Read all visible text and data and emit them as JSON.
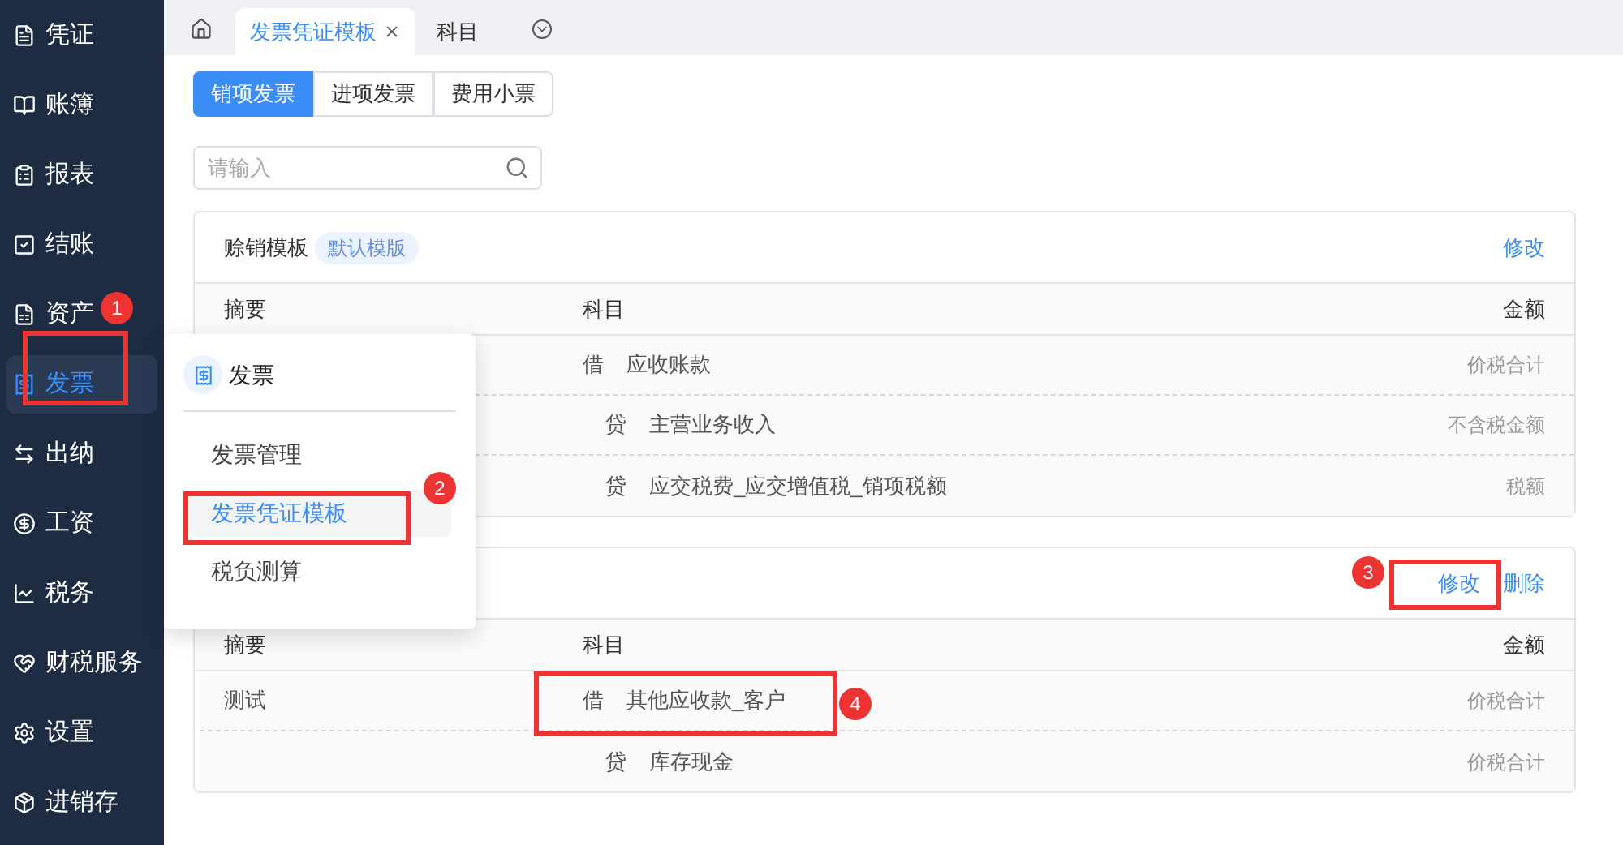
{
  "sidebar": {
    "items": [
      {
        "label": "凭证",
        "selected": false
      },
      {
        "label": "账簿",
        "selected": false
      },
      {
        "label": "报表",
        "selected": false
      },
      {
        "label": "结账",
        "selected": false
      },
      {
        "label": "资产",
        "selected": false
      },
      {
        "label": "发票",
        "selected": true
      },
      {
        "label": "出纳",
        "selected": false
      },
      {
        "label": "工资",
        "selected": false
      },
      {
        "label": "税务",
        "selected": false
      },
      {
        "label": "财税服务",
        "selected": false
      },
      {
        "label": "设置",
        "selected": false
      },
      {
        "label": "进销存",
        "selected": false
      }
    ]
  },
  "tabs": [
    {
      "label": "发票凭证模板",
      "selected": true,
      "closable": true
    },
    {
      "label": "科目",
      "selected": false,
      "closable": false
    }
  ],
  "segments": [
    {
      "label": "销项发票",
      "selected": true
    },
    {
      "label": "进项发票",
      "selected": false
    },
    {
      "label": "费用小票",
      "selected": false
    }
  ],
  "search": {
    "placeholder": "请输入"
  },
  "cards": [
    {
      "title": "赊销模板",
      "tag": "默认模版",
      "actions": [
        "修改"
      ],
      "columns": [
        "摘要",
        "科目",
        "金额"
      ],
      "rows": [
        {
          "kind": "debit",
          "direction": "借",
          "account": "应收账款",
          "amount": "价税合计"
        },
        {
          "kind": "credit",
          "direction": "贷",
          "account": "主营业务收入",
          "amount": "不含税金额"
        },
        {
          "kind": "credit",
          "direction": "贷",
          "account": "应交税费_应交增值税_销项税额",
          "amount": "税额"
        }
      ]
    },
    {
      "actions": [
        "修改",
        "删除"
      ],
      "columns": [
        "摘要",
        "科目",
        "金额"
      ],
      "rows": [
        {
          "summary": "测试",
          "kind": "debit",
          "direction": "借",
          "account": "其他应收款_客户",
          "amount": "价税合计"
        },
        {
          "kind": "credit",
          "direction": "贷",
          "account": "库存现金",
          "amount": "价税合计"
        }
      ]
    }
  ],
  "popup": {
    "title": "发票",
    "items": [
      {
        "label": "发票管理",
        "selected": false
      },
      {
        "label": "发票凭证模板",
        "selected": true
      },
      {
        "label": "税负测算",
        "selected": false
      }
    ]
  },
  "annotations": [
    {
      "number": "1"
    },
    {
      "number": "2"
    },
    {
      "number": "3"
    },
    {
      "number": "4"
    }
  ]
}
